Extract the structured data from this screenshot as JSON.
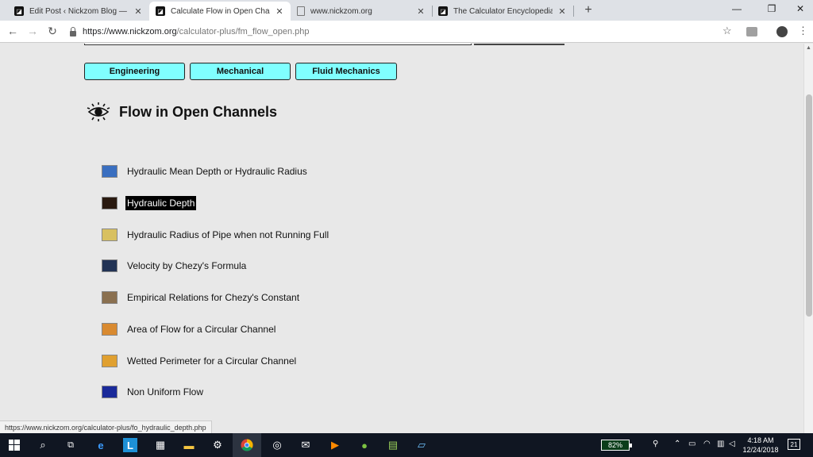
{
  "browser": {
    "tabs": [
      {
        "title": "Edit Post ‹ Nickzom Blog — Wor",
        "active": false
      },
      {
        "title": "Calculate Flow in Open Channels",
        "active": true
      },
      {
        "title": "www.nickzom.org",
        "active": false
      },
      {
        "title": "The Calculator Encyclopedia Calc",
        "active": false
      }
    ],
    "url_host": "https://www.nickzom.org",
    "url_path": "/calculator-plus/fm_flow_open.php",
    "status_url": "https://www.nickzom.org/calculator-plus/fo_hydraulic_depth.php"
  },
  "page": {
    "categories": [
      "Engineering",
      "Mechanical",
      "Fluid Mechanics"
    ],
    "heading": "Flow in Open Channels",
    "items": [
      {
        "label": "Hydraulic Mean Depth or Hydraulic Radius",
        "selected": false,
        "thumb_color": "#3a6fc0"
      },
      {
        "label": "Hydraulic Depth",
        "selected": true,
        "thumb_color": "#2a1a10"
      },
      {
        "label": "Hydraulic Radius of Pipe when not Running Full",
        "selected": false,
        "thumb_color": "#d8c060"
      },
      {
        "label": "Velocity by Chezy's Formula",
        "selected": false,
        "thumb_color": "#223355"
      },
      {
        "label": "Empirical Relations for Chezy's Constant",
        "selected": false,
        "thumb_color": "#8a7050"
      },
      {
        "label": "Area of Flow for a Circular Channel",
        "selected": false,
        "thumb_color": "#d98a30"
      },
      {
        "label": "Wetted Perimeter for a Circular Channel",
        "selected": false,
        "thumb_color": "#e0a030"
      },
      {
        "label": "Non Uniform Flow",
        "selected": false,
        "thumb_color": "#1a2a9a"
      }
    ]
  },
  "taskbar": {
    "battery": "82%",
    "time": "4:18 AM",
    "date": "12/24/2018",
    "notifications": "21"
  },
  "colors": {
    "category_button": "#80ffff",
    "page_background": "#e8e8e8",
    "selected_bg": "#000000"
  }
}
